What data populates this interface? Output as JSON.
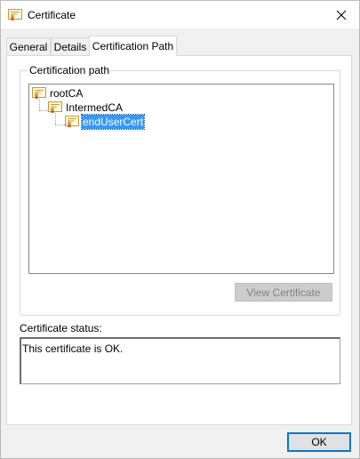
{
  "window": {
    "title": "Certificate"
  },
  "tabs": [
    {
      "label": "General"
    },
    {
      "label": "Details"
    },
    {
      "label": "Certification Path"
    }
  ],
  "path_group": {
    "label": "Certification path",
    "nodes": [
      {
        "label": "rootCA",
        "level": 0,
        "selected": false
      },
      {
        "label": "IntermedCA",
        "level": 1,
        "selected": false
      },
      {
        "label": "endUserCert",
        "level": 2,
        "selected": true
      }
    ],
    "view_button": "View Certificate"
  },
  "status": {
    "label": "Certificate status:",
    "text": "This certificate is OK."
  },
  "footer": {
    "ok_label": "OK"
  },
  "colors": {
    "selection": "#3399ff",
    "focus_border": "#0078d7",
    "panel": "#ffffff",
    "chrome": "#f0f0f0"
  }
}
